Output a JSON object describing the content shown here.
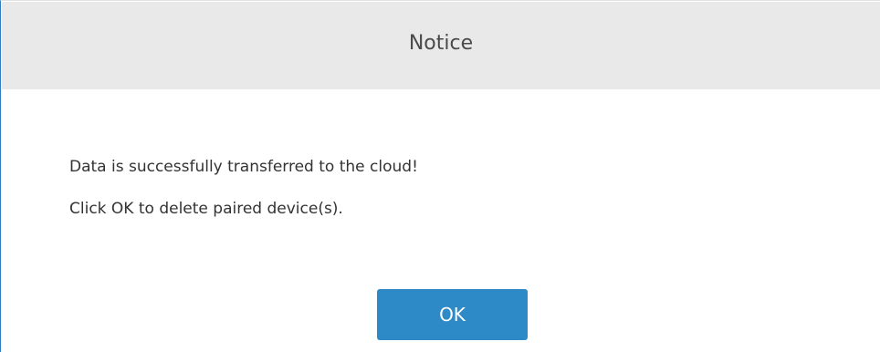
{
  "dialog": {
    "title": "Notice",
    "messages": [
      "Data is successfully transferred to the cloud!",
      "Click OK to delete paired device(s)."
    ],
    "ok_label": "OK"
  },
  "colors": {
    "header_background": "#e9e9e9",
    "accent": "#2d8ac7",
    "dialog_border": "#2f7fc1",
    "text": "#333333"
  }
}
